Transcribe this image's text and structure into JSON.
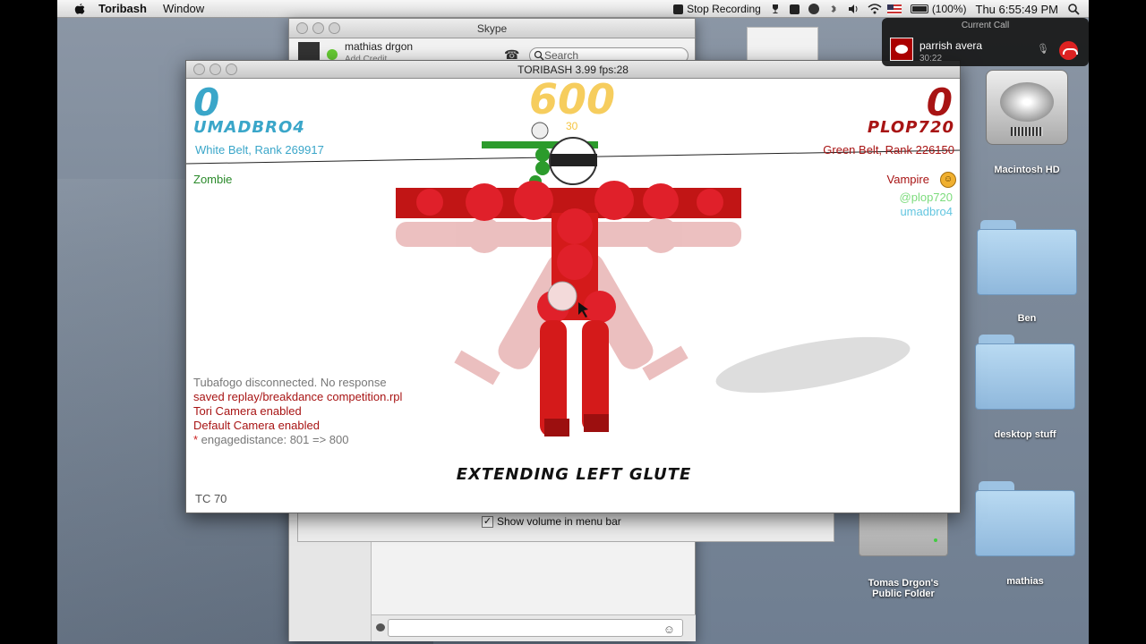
{
  "menubar": {
    "app_name": "Toribash",
    "menus": [
      "Window"
    ],
    "recording": "Stop Recording",
    "battery": "(100%)",
    "clock": "Thu 6:55:49 PM"
  },
  "current_call": {
    "title": "Current Call",
    "name": "parrish avera",
    "duration": "30:22"
  },
  "desktop_icons": {
    "hd": "Macintosh HD",
    "ben": "Ben",
    "desktop_stuff": "desktop stuff",
    "public_folder": "Tomas Drgon's Public Folder",
    "mathias": "mathias"
  },
  "skype": {
    "title": "Skype",
    "user": "mathias drgon",
    "credit": "Add Credit",
    "search_placeholder": "Search"
  },
  "prefs": {
    "checkbox_label": "Show volume in menu bar",
    "checkmark": "✓"
  },
  "toribash": {
    "title": "TORIBASH 3.99 fps:28",
    "left_score": "0",
    "left_player": "UMADBRO4",
    "left_rank": "White Belt, Rank 269917",
    "right_score": "0",
    "right_player": "PLOP720",
    "right_rank": "Green Belt, Rank 226150",
    "timer": "600",
    "turn": "30",
    "left_mod": "Zombie",
    "right_mod": "Vampire",
    "spectators": [
      "@plop720",
      "umadbro4"
    ],
    "console": [
      {
        "text": "Tubafogo disconnected. No response",
        "color": "gray"
      },
      {
        "text": "saved replay/breakdance competition.rpl",
        "color": "red"
      },
      {
        "text": "Tori Camera enabled",
        "color": "red"
      },
      {
        "text": "Default Camera enabled",
        "color": "red"
      },
      {
        "star": "*",
        "text": " engagedistance: 801 => 800",
        "color": "gray"
      }
    ],
    "move": "EXTENDING LEFT GLUTE",
    "tc": "TC 70"
  }
}
